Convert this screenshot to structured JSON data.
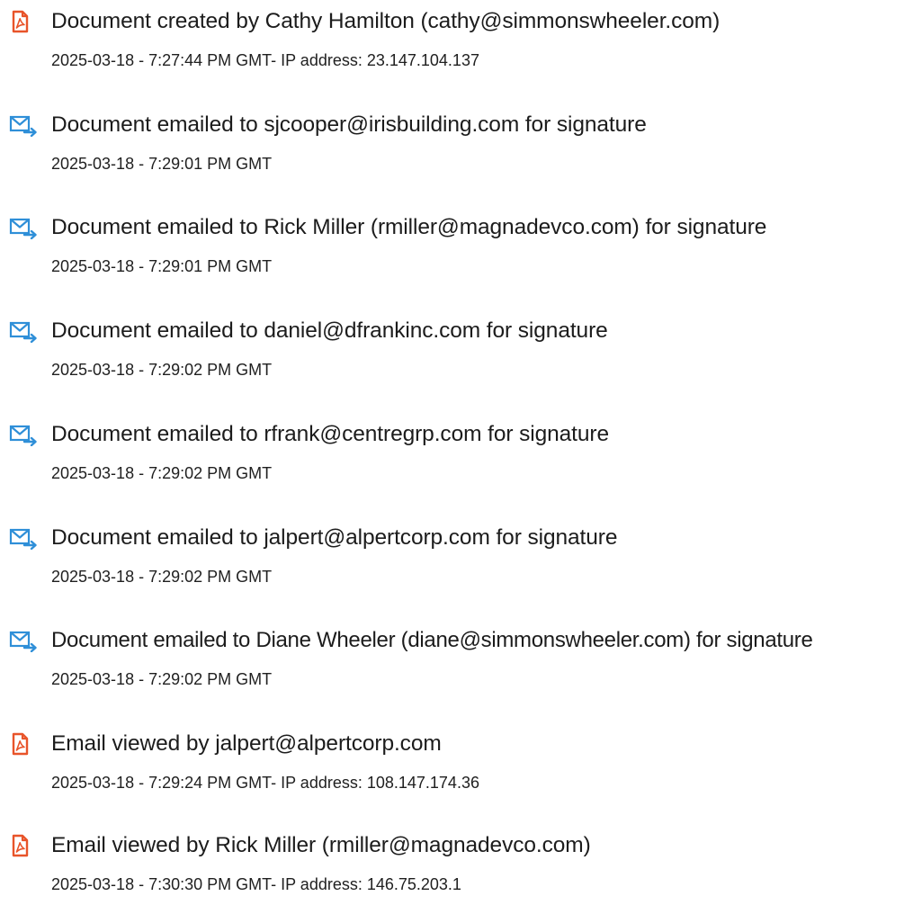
{
  "colors": {
    "pdf_icon": "#e8542a",
    "mail_icon": "#2f8fd8",
    "text": "#1c1c1c"
  },
  "events": [
    {
      "icon": "pdf-document-icon",
      "text": "Document created by Cathy Hamilton (cathy@simmonswheeler.com)",
      "meta": "2025-03-18 - 7:27:44 PM GMT- IP address: 23.147.104.137"
    },
    {
      "icon": "email-sent-icon",
      "text": "Document emailed to sjcooper@irisbuilding.com for signature",
      "meta": "2025-03-18 - 7:29:01 PM GMT"
    },
    {
      "icon": "email-sent-icon",
      "text": "Document emailed to Rick Miller (rmiller@magnadevco.com) for signature",
      "meta": "2025-03-18 - 7:29:01 PM GMT"
    },
    {
      "icon": "email-sent-icon",
      "text": "Document emailed to daniel@dfrankinc.com for signature",
      "meta": "2025-03-18 - 7:29:02 PM GMT"
    },
    {
      "icon": "email-sent-icon",
      "text": "Document emailed to rfrank@centregrp.com for signature",
      "meta": "2025-03-18 - 7:29:02 PM GMT"
    },
    {
      "icon": "email-sent-icon",
      "text": "Document emailed to jalpert@alpertcorp.com for signature",
      "meta": "2025-03-18 - 7:29:02 PM GMT"
    },
    {
      "icon": "email-sent-icon",
      "text": "Document emailed to Diane Wheeler (diane@simmonswheeler.com) for signature",
      "meta": "2025-03-18 - 7:29:02 PM GMT"
    },
    {
      "icon": "pdf-document-icon",
      "text": "Email viewed by jalpert@alpertcorp.com",
      "meta": "2025-03-18 - 7:29:24 PM GMT- IP address: 108.147.174.36"
    },
    {
      "icon": "pdf-document-icon",
      "text": "Email viewed by Rick Miller (rmiller@magnadevco.com)",
      "meta": "2025-03-18 - 7:30:30 PM GMT- IP address: 146.75.203.1"
    }
  ]
}
